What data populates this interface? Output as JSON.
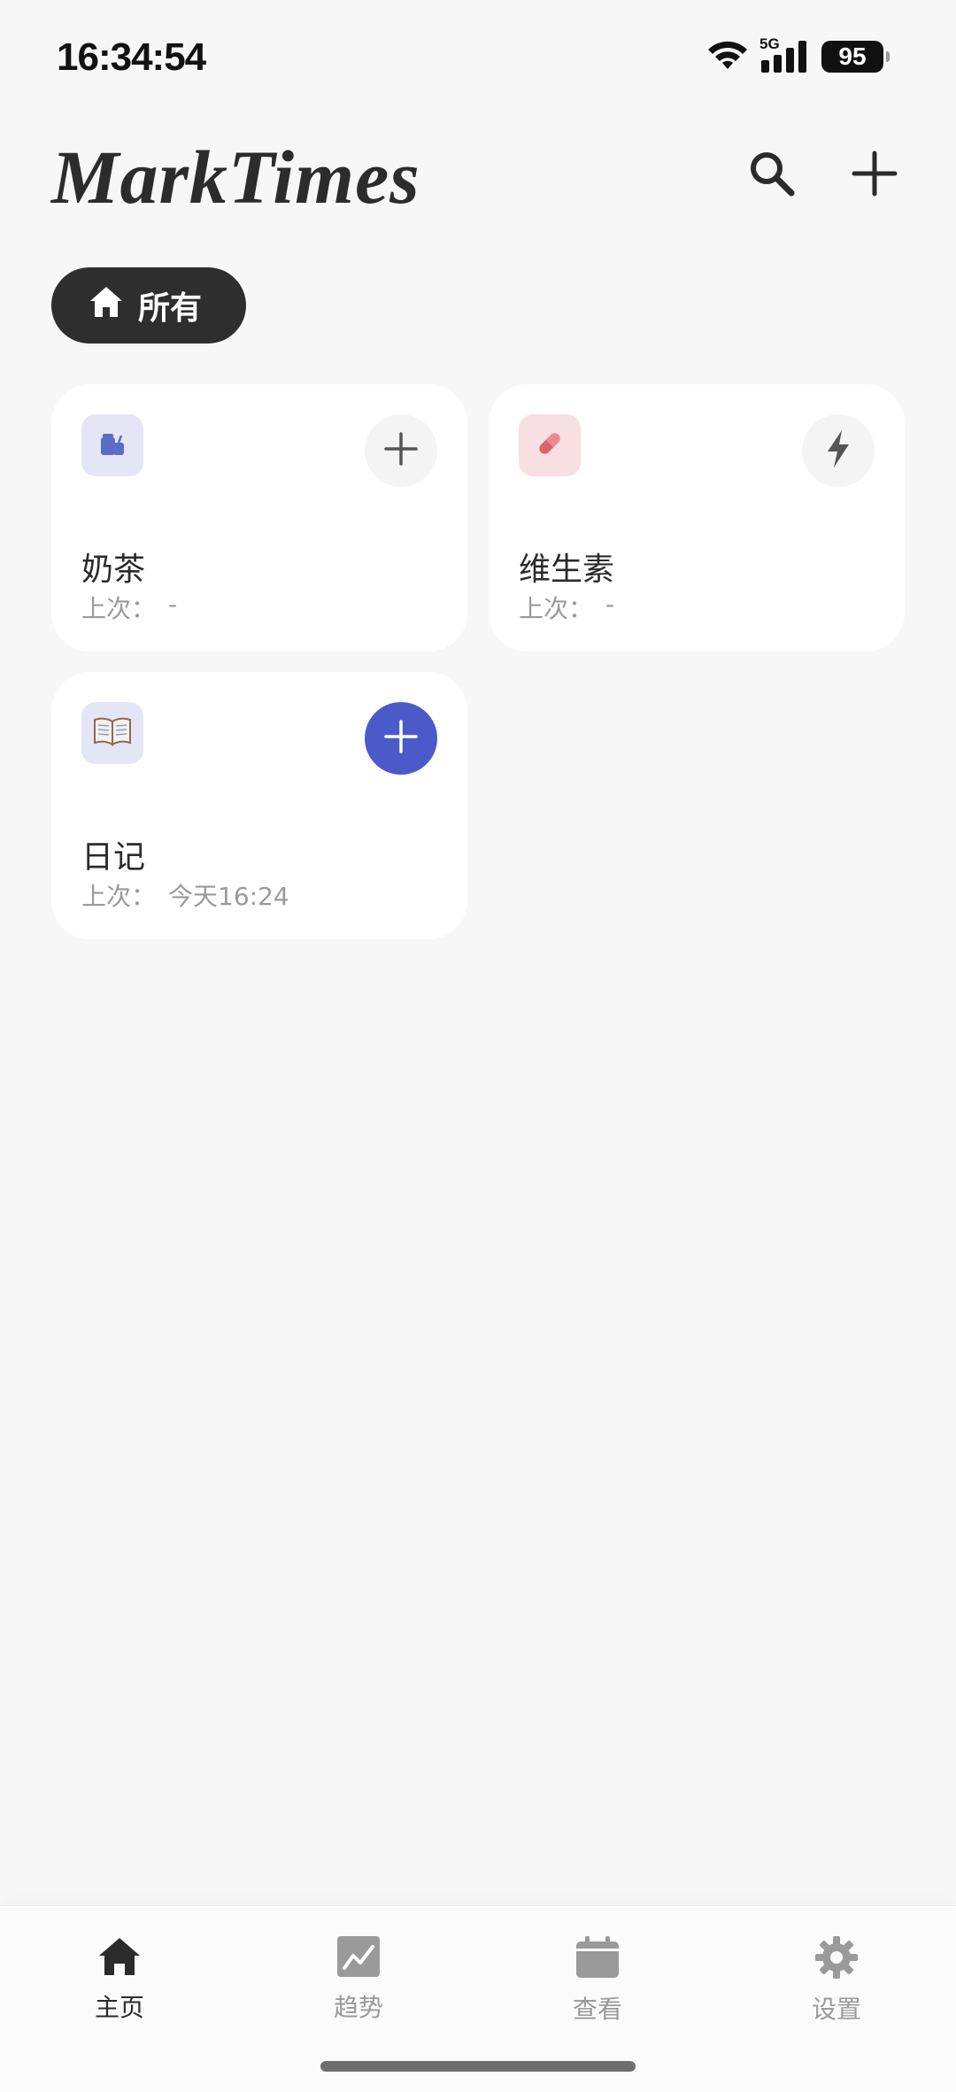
{
  "status_bar": {
    "time": "16:34:54",
    "network": "5G",
    "battery": "95"
  },
  "header": {
    "title": "MarkTimes",
    "search_icon": "search-icon",
    "add_icon": "plus-icon"
  },
  "filter": {
    "label": "所有",
    "icon": "home-icon"
  },
  "cards": [
    {
      "title": "奶茶",
      "last_label": "上次：",
      "last_value": "-",
      "icon": "milk-tea-icon",
      "icon_bg": "#e4e6f5",
      "action_icon": "plus-icon"
    },
    {
      "title": "维生素",
      "last_label": "上次：",
      "last_value": "-",
      "icon": "pill-icon",
      "icon_bg": "#f8dfe2",
      "action_icon": "lightning-icon"
    },
    {
      "title": "日记",
      "last_label": "上次：",
      "last_value": "今天16:24",
      "icon": "book-icon",
      "icon_bg": "#e4e6f5",
      "action_icon": "plus-icon"
    }
  ],
  "bottom_nav": {
    "items": [
      {
        "label": "主页",
        "icon": "home-icon",
        "active": true
      },
      {
        "label": "趋势",
        "icon": "trend-chart-icon",
        "active": false
      },
      {
        "label": "查看",
        "icon": "calendar-icon",
        "active": false
      },
      {
        "label": "设置",
        "icon": "gear-icon",
        "active": false
      }
    ]
  },
  "colors": {
    "accent": "#4a5bc9",
    "chip_bg": "#2e2e2e",
    "background": "#f7f7f7"
  }
}
